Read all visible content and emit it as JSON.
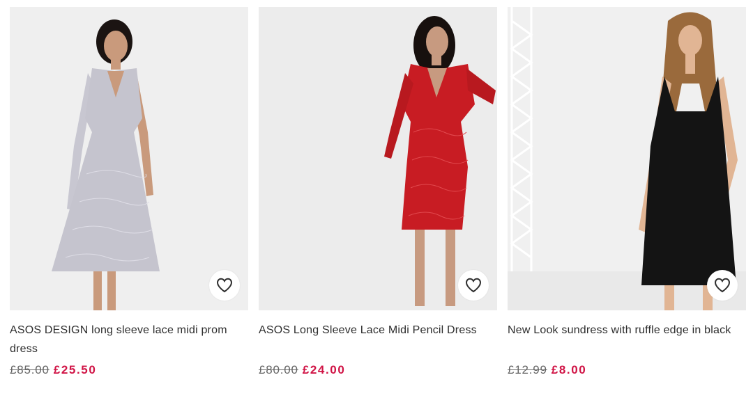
{
  "products": [
    {
      "title": "ASOS DESIGN long sleeve lace midi prom dress",
      "was_price": "£85.00",
      "now_price": "£25.50",
      "image_icon": "model-grey-lace-dress",
      "save_icon": "heart-icon"
    },
    {
      "title": "ASOS Long Sleeve Lace Midi Pencil Dress",
      "was_price": "£80.00",
      "now_price": "£24.00",
      "image_icon": "model-red-lace-dress",
      "save_icon": "heart-icon"
    },
    {
      "title": "New Look sundress with ruffle edge in black",
      "was_price": "£12.99",
      "now_price": "£8.00",
      "image_icon": "model-black-sundress",
      "save_icon": "heart-icon"
    }
  ],
  "colors": {
    "sale_price": "#d01345",
    "text": "#2d2d2d",
    "image_bg": "#eeeeee"
  }
}
